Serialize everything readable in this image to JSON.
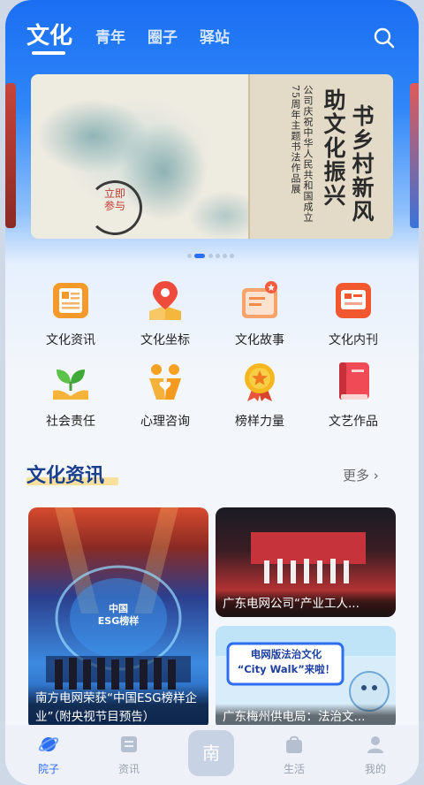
{
  "header": {
    "tabs": [
      {
        "label": "文化",
        "active": true
      },
      {
        "label": "青年",
        "active": false
      },
      {
        "label": "圈子",
        "active": false
      },
      {
        "label": "驿站",
        "active": false
      }
    ],
    "search_icon": "search-icon"
  },
  "banner": {
    "title_line1": "书乡村新风",
    "title_line2": "助文化振兴",
    "subtitle": "公司庆祝中华人民共和国成立75周年主题书法作品展",
    "seal_text": "立即参与",
    "pages": 6,
    "active_page": 2
  },
  "grid": [
    {
      "label": "文化资讯",
      "icon": "news-doc-icon"
    },
    {
      "label": "文化坐标",
      "icon": "map-pin-icon"
    },
    {
      "label": "文化故事",
      "icon": "story-book-icon"
    },
    {
      "label": "文化内刊",
      "icon": "magazine-icon"
    },
    {
      "label": "社会责任",
      "icon": "sprout-hands-icon"
    },
    {
      "label": "心理咨询",
      "icon": "people-heart-icon"
    },
    {
      "label": "榜样力量",
      "icon": "medal-icon"
    },
    {
      "label": "文艺作品",
      "icon": "red-book-icon"
    }
  ],
  "news": {
    "title": "文化资讯",
    "more": "更多 ›",
    "cards": [
      {
        "caption": "南方电网荣获“中国ESG榜样企业”（附央视节目预告）",
        "badge": "中国\nESG榜样"
      },
      {
        "caption": "广东电网公司“产业工人..."
      },
      {
        "caption": "广东梅州供电局：法治文...",
        "poster_text": "电网版法治文化\n“City Walk”来啦！"
      }
    ]
  },
  "bottom_nav": {
    "items": [
      {
        "label": "院子",
        "icon": "planet-icon",
        "active": true
      },
      {
        "label": "资讯",
        "icon": "book-icon",
        "active": false
      },
      {
        "label": "生活",
        "icon": "bag-icon",
        "active": false
      },
      {
        "label": "我的",
        "icon": "user-icon",
        "active": false
      }
    ],
    "center_label": "南"
  },
  "colors": {
    "primary": "#2d6ef0",
    "header": "#1a6ef2",
    "title": "#1b3f8f"
  }
}
